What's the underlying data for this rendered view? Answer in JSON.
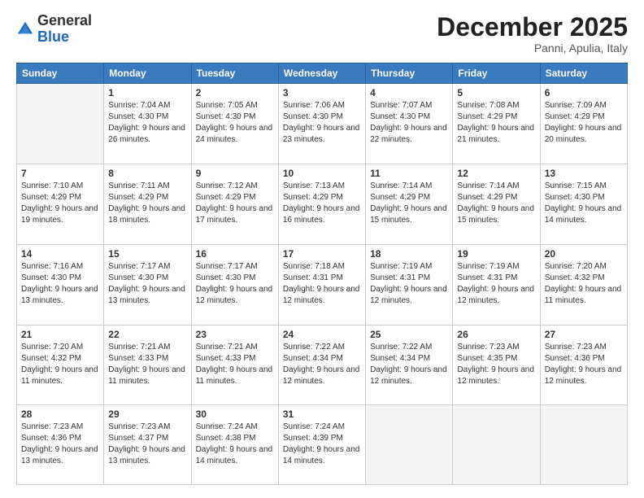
{
  "logo": {
    "general": "General",
    "blue": "Blue"
  },
  "header": {
    "month": "December 2025",
    "location": "Panni, Apulia, Italy"
  },
  "weekdays": [
    "Sunday",
    "Monday",
    "Tuesday",
    "Wednesday",
    "Thursday",
    "Friday",
    "Saturday"
  ],
  "weeks": [
    [
      {
        "day": "",
        "sunrise": "",
        "sunset": "",
        "daylight": ""
      },
      {
        "day": "1",
        "sunrise": "Sunrise: 7:04 AM",
        "sunset": "Sunset: 4:30 PM",
        "daylight": "Daylight: 9 hours and 26 minutes."
      },
      {
        "day": "2",
        "sunrise": "Sunrise: 7:05 AM",
        "sunset": "Sunset: 4:30 PM",
        "daylight": "Daylight: 9 hours and 24 minutes."
      },
      {
        "day": "3",
        "sunrise": "Sunrise: 7:06 AM",
        "sunset": "Sunset: 4:30 PM",
        "daylight": "Daylight: 9 hours and 23 minutes."
      },
      {
        "day": "4",
        "sunrise": "Sunrise: 7:07 AM",
        "sunset": "Sunset: 4:30 PM",
        "daylight": "Daylight: 9 hours and 22 minutes."
      },
      {
        "day": "5",
        "sunrise": "Sunrise: 7:08 AM",
        "sunset": "Sunset: 4:29 PM",
        "daylight": "Daylight: 9 hours and 21 minutes."
      },
      {
        "day": "6",
        "sunrise": "Sunrise: 7:09 AM",
        "sunset": "Sunset: 4:29 PM",
        "daylight": "Daylight: 9 hours and 20 minutes."
      }
    ],
    [
      {
        "day": "7",
        "sunrise": "Sunrise: 7:10 AM",
        "sunset": "Sunset: 4:29 PM",
        "daylight": "Daylight: 9 hours and 19 minutes."
      },
      {
        "day": "8",
        "sunrise": "Sunrise: 7:11 AM",
        "sunset": "Sunset: 4:29 PM",
        "daylight": "Daylight: 9 hours and 18 minutes."
      },
      {
        "day": "9",
        "sunrise": "Sunrise: 7:12 AM",
        "sunset": "Sunset: 4:29 PM",
        "daylight": "Daylight: 9 hours and 17 minutes."
      },
      {
        "day": "10",
        "sunrise": "Sunrise: 7:13 AM",
        "sunset": "Sunset: 4:29 PM",
        "daylight": "Daylight: 9 hours and 16 minutes."
      },
      {
        "day": "11",
        "sunrise": "Sunrise: 7:14 AM",
        "sunset": "Sunset: 4:29 PM",
        "daylight": "Daylight: 9 hours and 15 minutes."
      },
      {
        "day": "12",
        "sunrise": "Sunrise: 7:14 AM",
        "sunset": "Sunset: 4:29 PM",
        "daylight": "Daylight: 9 hours and 15 minutes."
      },
      {
        "day": "13",
        "sunrise": "Sunrise: 7:15 AM",
        "sunset": "Sunset: 4:30 PM",
        "daylight": "Daylight: 9 hours and 14 minutes."
      }
    ],
    [
      {
        "day": "14",
        "sunrise": "Sunrise: 7:16 AM",
        "sunset": "Sunset: 4:30 PM",
        "daylight": "Daylight: 9 hours and 13 minutes."
      },
      {
        "day": "15",
        "sunrise": "Sunrise: 7:17 AM",
        "sunset": "Sunset: 4:30 PM",
        "daylight": "Daylight: 9 hours and 13 minutes."
      },
      {
        "day": "16",
        "sunrise": "Sunrise: 7:17 AM",
        "sunset": "Sunset: 4:30 PM",
        "daylight": "Daylight: 9 hours and 12 minutes."
      },
      {
        "day": "17",
        "sunrise": "Sunrise: 7:18 AM",
        "sunset": "Sunset: 4:31 PM",
        "daylight": "Daylight: 9 hours and 12 minutes."
      },
      {
        "day": "18",
        "sunrise": "Sunrise: 7:19 AM",
        "sunset": "Sunset: 4:31 PM",
        "daylight": "Daylight: 9 hours and 12 minutes."
      },
      {
        "day": "19",
        "sunrise": "Sunrise: 7:19 AM",
        "sunset": "Sunset: 4:31 PM",
        "daylight": "Daylight: 9 hours and 12 minutes."
      },
      {
        "day": "20",
        "sunrise": "Sunrise: 7:20 AM",
        "sunset": "Sunset: 4:32 PM",
        "daylight": "Daylight: 9 hours and 11 minutes."
      }
    ],
    [
      {
        "day": "21",
        "sunrise": "Sunrise: 7:20 AM",
        "sunset": "Sunset: 4:32 PM",
        "daylight": "Daylight: 9 hours and 11 minutes."
      },
      {
        "day": "22",
        "sunrise": "Sunrise: 7:21 AM",
        "sunset": "Sunset: 4:33 PM",
        "daylight": "Daylight: 9 hours and 11 minutes."
      },
      {
        "day": "23",
        "sunrise": "Sunrise: 7:21 AM",
        "sunset": "Sunset: 4:33 PM",
        "daylight": "Daylight: 9 hours and 11 minutes."
      },
      {
        "day": "24",
        "sunrise": "Sunrise: 7:22 AM",
        "sunset": "Sunset: 4:34 PM",
        "daylight": "Daylight: 9 hours and 12 minutes."
      },
      {
        "day": "25",
        "sunrise": "Sunrise: 7:22 AM",
        "sunset": "Sunset: 4:34 PM",
        "daylight": "Daylight: 9 hours and 12 minutes."
      },
      {
        "day": "26",
        "sunrise": "Sunrise: 7:23 AM",
        "sunset": "Sunset: 4:35 PM",
        "daylight": "Daylight: 9 hours and 12 minutes."
      },
      {
        "day": "27",
        "sunrise": "Sunrise: 7:23 AM",
        "sunset": "Sunset: 4:36 PM",
        "daylight": "Daylight: 9 hours and 12 minutes."
      }
    ],
    [
      {
        "day": "28",
        "sunrise": "Sunrise: 7:23 AM",
        "sunset": "Sunset: 4:36 PM",
        "daylight": "Daylight: 9 hours and 13 minutes."
      },
      {
        "day": "29",
        "sunrise": "Sunrise: 7:23 AM",
        "sunset": "Sunset: 4:37 PM",
        "daylight": "Daylight: 9 hours and 13 minutes."
      },
      {
        "day": "30",
        "sunrise": "Sunrise: 7:24 AM",
        "sunset": "Sunset: 4:38 PM",
        "daylight": "Daylight: 9 hours and 14 minutes."
      },
      {
        "day": "31",
        "sunrise": "Sunrise: 7:24 AM",
        "sunset": "Sunset: 4:39 PM",
        "daylight": "Daylight: 9 hours and 14 minutes."
      },
      {
        "day": "",
        "sunrise": "",
        "sunset": "",
        "daylight": ""
      },
      {
        "day": "",
        "sunrise": "",
        "sunset": "",
        "daylight": ""
      },
      {
        "day": "",
        "sunrise": "",
        "sunset": "",
        "daylight": ""
      }
    ]
  ]
}
